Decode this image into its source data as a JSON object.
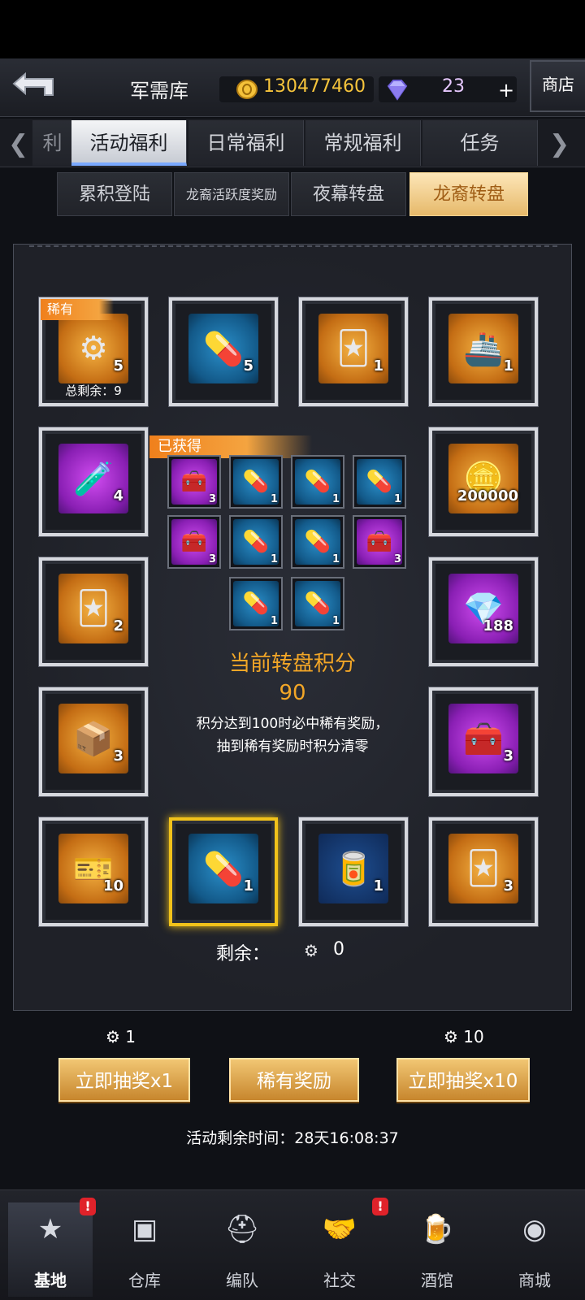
{
  "header": {
    "title": "军需库",
    "gold": "130477460",
    "gems": "23",
    "plus": "+",
    "shop": "商店"
  },
  "tabs": [
    {
      "label": "利"
    },
    {
      "label": "活动福利"
    },
    {
      "label": "日常福利"
    },
    {
      "label": "常规福利"
    },
    {
      "label": "任务"
    }
  ],
  "subtabs": [
    {
      "label": "累积登陆"
    },
    {
      "label": "龙裔活跃度奖励"
    },
    {
      "label": "夜幕转盘"
    },
    {
      "label": "龙裔转盘"
    }
  ],
  "items": [
    {
      "icon": "machine-core-icon",
      "count": "5",
      "rare": "稀有",
      "remaining": "总剩余：9"
    },
    {
      "icon": "blue-capsule-icon",
      "count": "5"
    },
    {
      "icon": "diamond-cards-icon",
      "count": "1"
    },
    {
      "icon": "ship-ticket-icon",
      "count": "1"
    },
    {
      "icon": "purple-capsule-icon",
      "count": "4"
    },
    {
      "icon": "gold-coins-icon",
      "count": "200000"
    },
    {
      "icon": "diamond-cards-icon",
      "count": "2"
    },
    {
      "icon": "diamonds-pile-icon",
      "count": "188"
    },
    {
      "icon": "white-box-icon",
      "count": "3"
    },
    {
      "icon": "purple-chest-icon",
      "count": "3"
    },
    {
      "icon": "character-ticket-icon",
      "count": "10"
    },
    {
      "icon": "blue-capsule-icon",
      "count": "1"
    },
    {
      "icon": "coating-icon",
      "count": "1"
    },
    {
      "icon": "diamond-cards-icon",
      "count": "3"
    }
  ],
  "obtained": {
    "label": "已获得",
    "items": [
      {
        "icon": "purple-chest-icon",
        "count": "3"
      },
      {
        "icon": "blue-capsule-icon",
        "count": "1"
      },
      {
        "icon": "blue-capsule-icon",
        "count": "1"
      },
      {
        "icon": "blue-capsule-icon",
        "count": "1"
      },
      {
        "icon": "purple-chest-icon",
        "count": "3"
      },
      {
        "icon": "blue-capsule-icon",
        "count": "1"
      },
      {
        "icon": "blue-capsule-icon",
        "count": "1"
      },
      {
        "icon": "purple-chest-icon",
        "count": "3"
      },
      {
        "icon": "blue-capsule-icon",
        "count": "1"
      },
      {
        "icon": "blue-capsule-icon",
        "count": "1"
      }
    ]
  },
  "score": {
    "label": "当前转盘积分",
    "value": "90",
    "desc1": "积分达到100时必中稀有奖励，",
    "desc2": "抽到稀有奖励时积分清零"
  },
  "remain": {
    "label": "剩余：",
    "value": "0"
  },
  "actions": {
    "cost1": "1",
    "cost10": "10",
    "draw1": "立即抽奖x1",
    "rare": "稀有奖励",
    "draw10": "立即抽奖x10"
  },
  "timer": "活动剩余时间：28天16:08:37",
  "nav": [
    {
      "label": "基地",
      "badge": "!"
    },
    {
      "label": "仓库"
    },
    {
      "label": "编队"
    },
    {
      "label": "社交",
      "badge": "!"
    },
    {
      "label": "酒馆"
    },
    {
      "label": "商城"
    }
  ]
}
